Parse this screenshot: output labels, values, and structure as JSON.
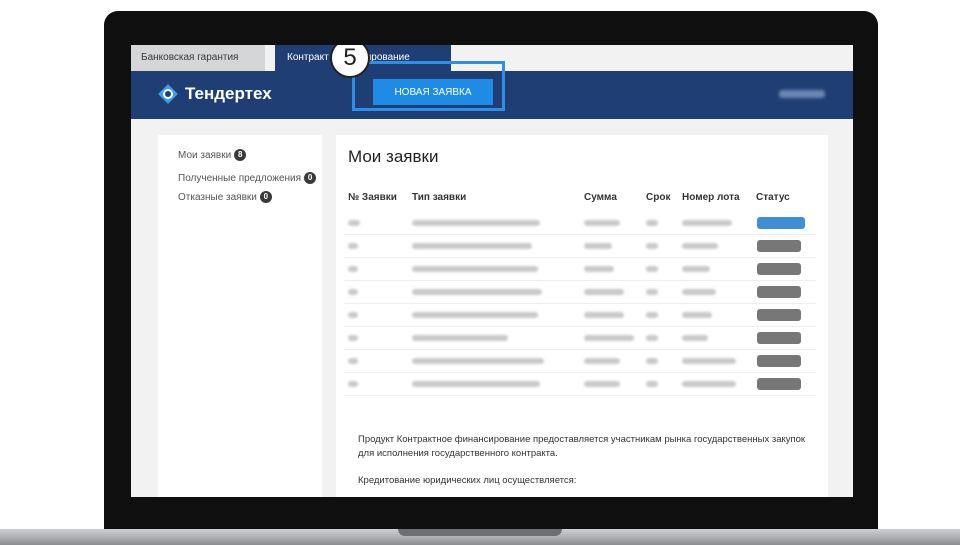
{
  "tabs": [
    {
      "label": "Банковская гарантия",
      "active": false
    },
    {
      "label": "Контракт",
      "active": true
    },
    {
      "label": "сирование",
      "active": true
    }
  ],
  "header": {
    "brand": "Тендертех",
    "new_request_label": "НОВАЯ ЗАЯВКА"
  },
  "tutorial": {
    "step": "5"
  },
  "sidebar": {
    "items": [
      {
        "label": "Мои заявки",
        "count": "8"
      },
      {
        "label": "Полученные предложения",
        "count": "0"
      },
      {
        "label": "Отказные заявки",
        "count": "0"
      }
    ]
  },
  "main": {
    "title": "Мои заявки",
    "columns": [
      "№ Заявки",
      "Тип заявки",
      "Сумма",
      "Срок",
      "Номер лота",
      "Статус"
    ],
    "description_1": "Продукт Контрактное финансирование предоставляется участникам рынка государственных закупок для исполнения государственного контракта.",
    "description_2": "Кредитование юридических лиц осуществляется:"
  },
  "colors": {
    "header_bg": "#1f3e73",
    "accent": "#1e8ce6",
    "highlight": "#2e8fe8"
  }
}
